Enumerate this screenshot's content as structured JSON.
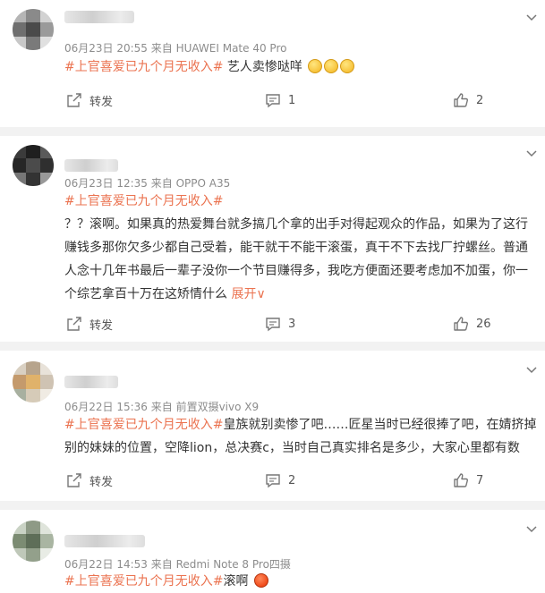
{
  "posts": [
    {
      "meta": "06月23日 20:55 来自 HUAWEI Mate 40 Pro",
      "hashtag": "#上官喜爱已九个月无收入#",
      "text": "艺人卖惨哒咩",
      "expand": "",
      "repost_label": "转发",
      "comment_count": "1",
      "like_count": "2"
    },
    {
      "meta": "06月23日 12:35 来自 OPPO A35",
      "hashtag": "#上官喜爱已九个月无收入#",
      "text": "？？滚啊。如果真的热爱舞台就多搞几个拿的出手对得起观众的作品，如果为了这行赚钱多那你欠多少都自己受着，能干就干不能干滚蛋，真干不下去找厂拧螺丝。普通人念十几年书最后一辈子没你一个节目赚得多，我吃方便面还要考虑加不加蛋，你一个综艺拿百十万在这矫情什么",
      "expand": "展开∨",
      "repost_label": "转发",
      "comment_count": "3",
      "like_count": "26"
    },
    {
      "meta": "06月22日 15:36 来自 前置双摄vivo X9",
      "hashtag": "#上官喜爱已九个月无收入#",
      "text": "皇族就别卖惨了吧……匠星当时已经很捧了吧，在婧挤掉别的妹妹的位置，空降lion，总决赛c，当时自己真实排名是多少，大家心里都有数",
      "expand": "",
      "repost_label": "转发",
      "comment_count": "2",
      "like_count": "7"
    },
    {
      "meta": "06月22日 14:53 来自 Redmi Note 8 Pro四摄",
      "hashtag": "#上官喜爱已九个月无收入#",
      "text": "滚啊",
      "expand": "",
      "repost_label": "",
      "comment_count": "",
      "like_count": ""
    }
  ],
  "colors": {
    "hashtag": "#eb7350",
    "meta": "#8c8c8c",
    "background": "#f2f2f2"
  },
  "icons": [
    "chevron-down-icon",
    "repost-icon",
    "comment-icon",
    "like-icon",
    "emoji-icon"
  ]
}
